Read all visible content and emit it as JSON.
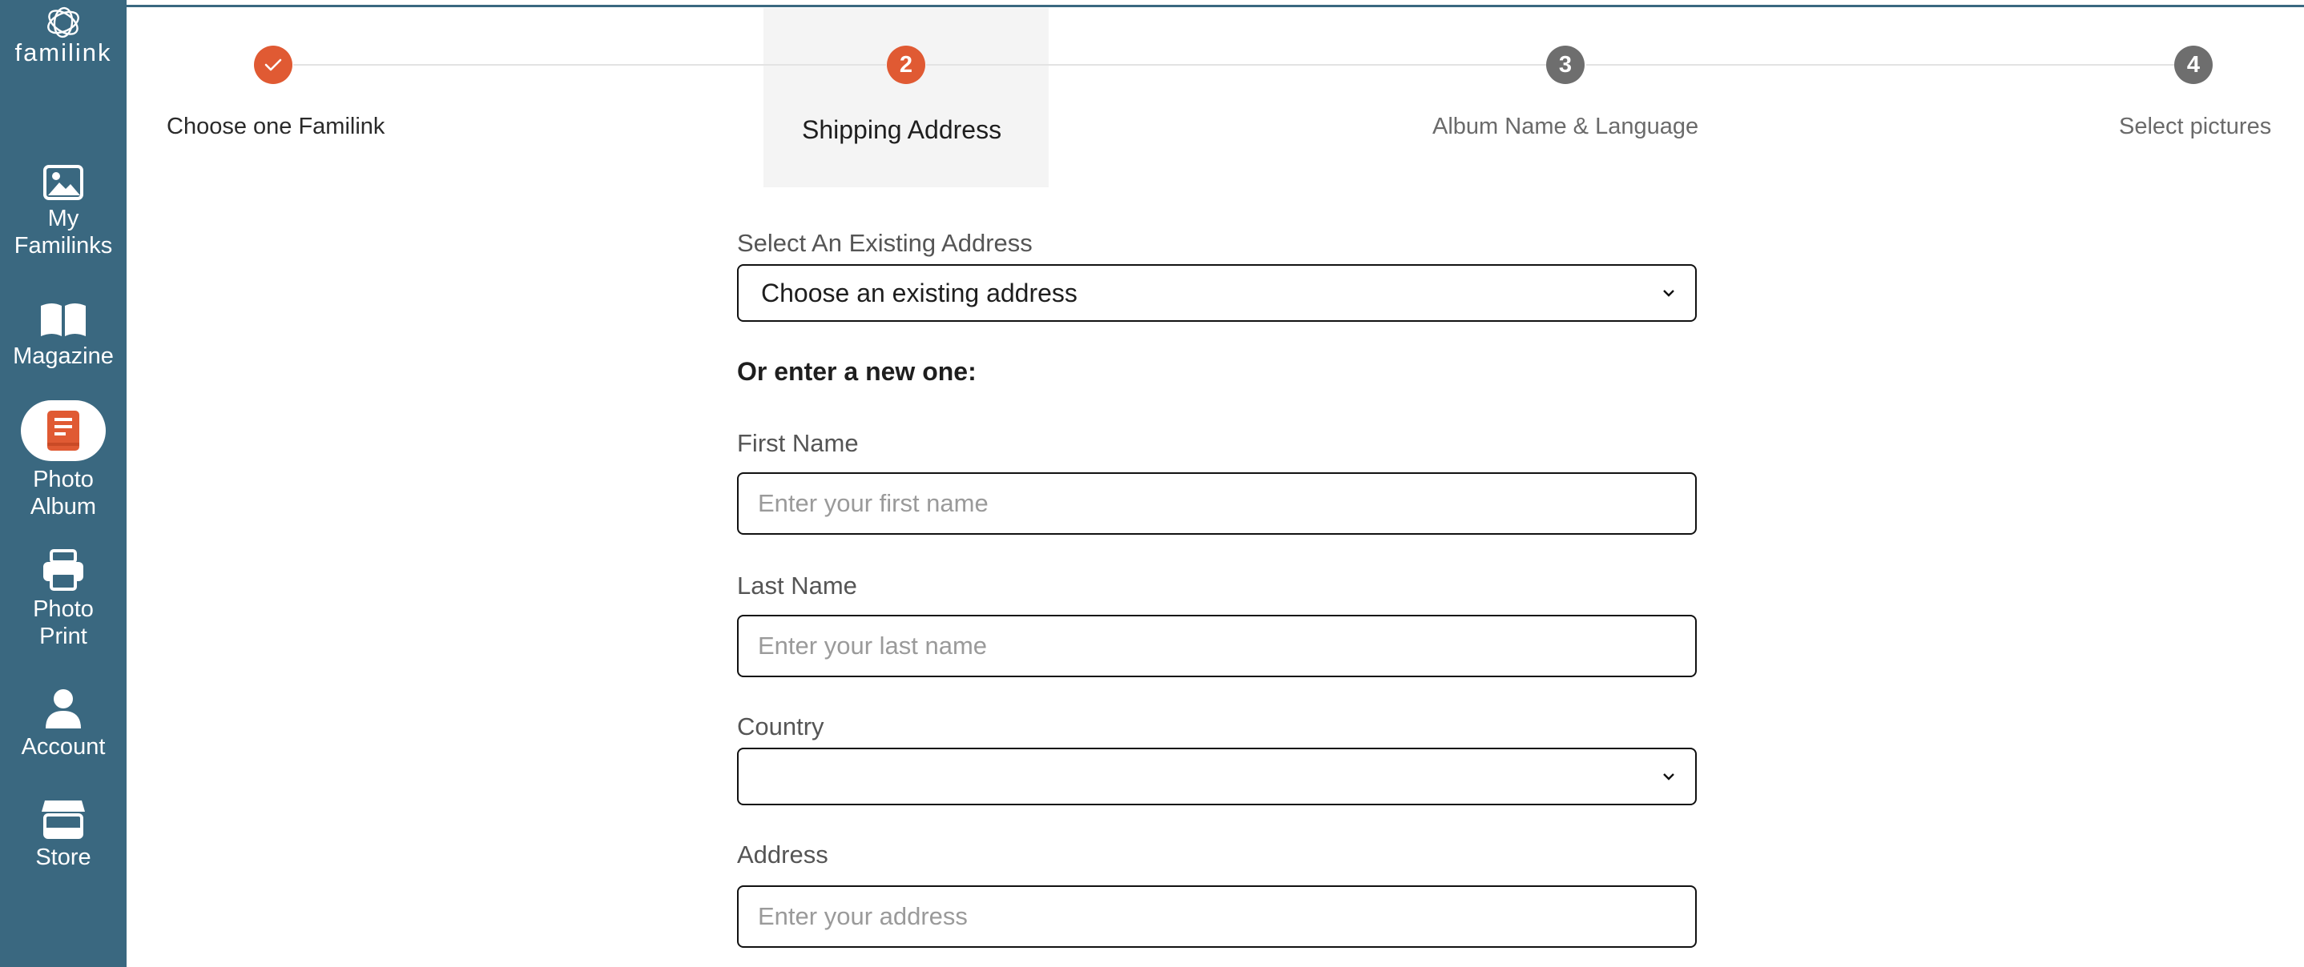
{
  "brand": {
    "name": "familink",
    "color": "#3a6880"
  },
  "sidebar": {
    "items": [
      {
        "label_lines": [
          "My",
          "Familinks"
        ],
        "icon": "image-icon"
      },
      {
        "label_lines": [
          "Magazine"
        ],
        "icon": "open-book-icon"
      },
      {
        "label_lines": [
          "Photo",
          "Album"
        ],
        "icon": "photo-album-icon",
        "active": true
      },
      {
        "label_lines": [
          "Photo",
          "Print"
        ],
        "icon": "printer-icon"
      },
      {
        "label_lines": [
          "Account"
        ],
        "icon": "user-icon"
      },
      {
        "label_lines": [
          "Store"
        ],
        "icon": "store-icon"
      }
    ]
  },
  "stepper": {
    "accent": "#e05a33",
    "inactive": "#6e6e6e",
    "steps": [
      {
        "number": "",
        "label": "Choose one Familink",
        "state": "done"
      },
      {
        "number": "2",
        "label": "Shipping Address",
        "state": "current"
      },
      {
        "number": "3",
        "label": "Album Name & Language",
        "state": "upcoming"
      },
      {
        "number": "4",
        "label": "Select pictures",
        "state": "upcoming"
      }
    ]
  },
  "form": {
    "existing_address": {
      "label": "Select An Existing Address",
      "value": "Choose an existing address"
    },
    "new_heading": "Or enter a new one:",
    "first_name": {
      "label": "First Name",
      "placeholder": "Enter your first name",
      "value": ""
    },
    "last_name": {
      "label": "Last Name",
      "placeholder": "Enter your last name",
      "value": ""
    },
    "country": {
      "label": "Country",
      "value": ""
    },
    "address": {
      "label": "Address",
      "placeholder": "Enter your address",
      "value": ""
    }
  }
}
